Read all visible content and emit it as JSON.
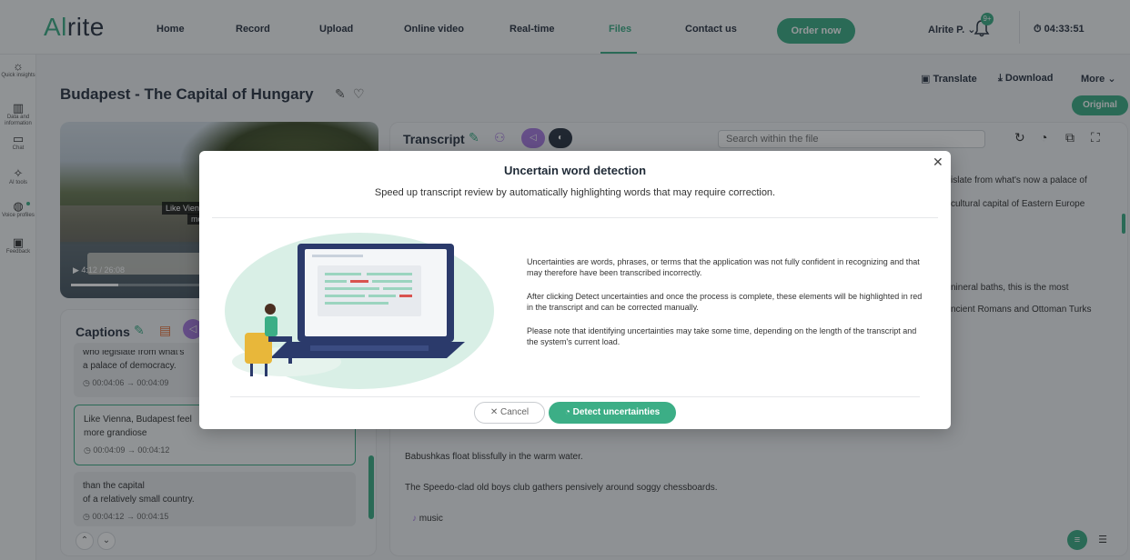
{
  "app": {
    "logo_prefix": "Al",
    "logo_suffix": "rite"
  },
  "nav": {
    "items": [
      "Home",
      "Record",
      "Upload",
      "Online video",
      "Real-time",
      "Files",
      "Contact us"
    ],
    "active": "Files",
    "order_label": "Order now",
    "user_label": "Alrite P. ⌄",
    "notification_badge": "9+",
    "timer": "04:33:51"
  },
  "rail": {
    "items": [
      {
        "label": "Quick insights",
        "icon": "bulb-icon"
      },
      {
        "label": "Data and information",
        "icon": "chart-icon"
      },
      {
        "label": "Chat",
        "icon": "chat-icon"
      },
      {
        "label": "AI tools",
        "icon": "ai-tools-icon"
      },
      {
        "label": "Voice profiles",
        "icon": "voice-icon"
      },
      {
        "label": "Feedback",
        "icon": "feedback-icon"
      }
    ]
  },
  "page": {
    "title": "Budapest - The Capital of Hungary",
    "translate_label": "Translate",
    "download_label": "Download",
    "more_label": "More ⌄",
    "original_label": "Original"
  },
  "video": {
    "subtitle_line1": "Like Vien",
    "subtitle_line2": "mo",
    "time": "4:12 / 26:08",
    "progress_fraction": 0.16
  },
  "captions": {
    "title": "Captions",
    "cards": [
      {
        "text1": "who legislate from what's",
        "text2": "a palace of democracy.",
        "time": "00:04:06 → 00:04:09"
      },
      {
        "text1": "Like Vienna, Budapest feel",
        "text2": "more grandiose",
        "time": "00:04:09 → 00:04:12"
      },
      {
        "text1": "than the capital",
        "text2": "of a relatively small country.",
        "time": "00:04:12 → 00:04:15"
      }
    ]
  },
  "transcript": {
    "title": "Transcript",
    "search_placeholder": "Search within the file",
    "right_fragments": [
      "islate from what's now a palace of",
      "cultural capital of Eastern Europe",
      "nineral baths, this is the most",
      "ncient Romans and Ottoman Turks"
    ],
    "lines": [
      "Babushkas float blissfully in the warm water.",
      "The Speedo-clad old boys club gathers pensively around soggy chessboards.",
      "music"
    ]
  },
  "modal": {
    "title": "Uncertain word detection",
    "subtitle": "Speed up transcript review by automatically highlighting words that may require correction.",
    "paragraphs": [
      "Uncertainties are words, phrases, or terms that the application was not fully confident in recognizing and that may therefore have been transcribed incorrectly.",
      "After clicking Detect uncertainties and once the process is complete, these elements will be highlighted in red in the transcript and can be corrected manually.",
      "Please note that identifying uncertainties may take some time, depending on the length of the transcript and the system's current load."
    ],
    "cancel_label": "Cancel",
    "detect_label": "Detect uncertainties"
  },
  "colors": {
    "accent": "#3cae86",
    "purple": "#a87be0",
    "navy": "#2b3442",
    "highlight_red": "#d9534f",
    "orange": "#e8703a"
  }
}
